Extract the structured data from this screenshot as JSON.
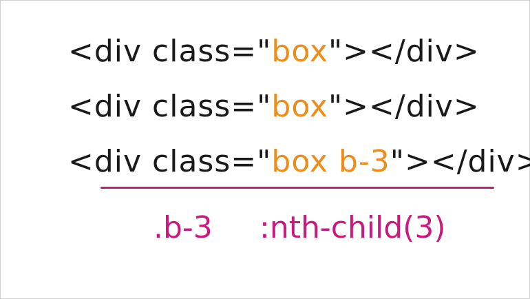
{
  "colors": {
    "text": "#1a1a1a",
    "accent_orange": "#ee8d1a",
    "accent_magenta": "#c81b7f"
  },
  "lines": [
    {
      "open": "<div class=\"",
      "class_text": "box",
      "close": "\"></div>"
    },
    {
      "open": "<div class=\"",
      "class_text": "box",
      "close": "\"></div>"
    },
    {
      "open": "<div class=\"",
      "class_text": "box b-3",
      "close": "\"></div>"
    }
  ],
  "selectors": {
    "class_selector": ".b-3",
    "pseudo_selector": ":nth-child(3)"
  }
}
